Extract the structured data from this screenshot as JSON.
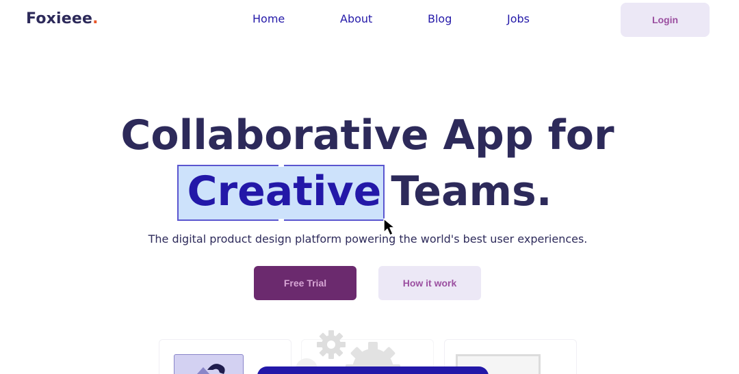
{
  "header": {
    "logo_text": "Foxieee",
    "logo_dot": ".",
    "nav": [
      "Home",
      "About",
      "Blog",
      "Jobs"
    ],
    "login_label": "Login"
  },
  "hero": {
    "line1": "Collaborative App for",
    "highlighted_word": "Creative",
    "line2_rest": "Teams.",
    "subtitle": "The digital product design platform powering the world's best user experiences."
  },
  "actions": {
    "primary_label": "Free Trial",
    "secondary_label": "How it work"
  },
  "colors": {
    "brand_dark": "#2d2a5a",
    "accent_blue": "#2318a8",
    "logo_dot": "#e8572a",
    "primary_button": "#6b2a6e",
    "secondary_button": "#ece8f6",
    "selection_bg": "#cde2fb"
  },
  "icons": [
    "cursor-arrow-icon",
    "gear-icon"
  ]
}
